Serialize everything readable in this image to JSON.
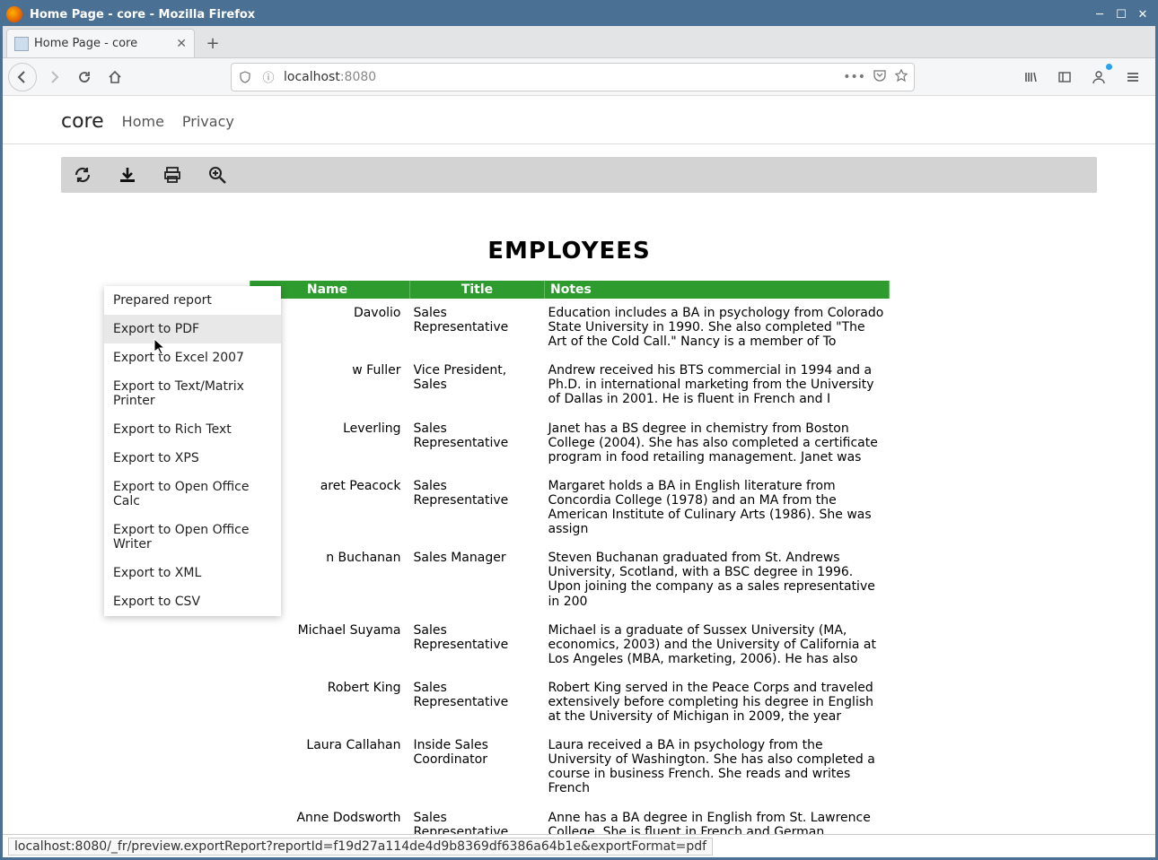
{
  "window": {
    "title": "Home Page - core - Mozilla Firefox"
  },
  "browser": {
    "tab_title": "Home Page - core",
    "url_host": "localhost",
    "url_port": ":8080"
  },
  "site": {
    "brand": "core",
    "nav": {
      "home": "Home",
      "privacy": "Privacy"
    }
  },
  "export_menu": {
    "items": [
      "Prepared report",
      "Export to PDF",
      "Export to Excel 2007",
      "Export to Text/Matrix Printer",
      "Export to Rich Text",
      "Export to XPS",
      "Export to Open Office Calc",
      "Export to Open Office Writer",
      "Export to XML",
      "Export to CSV"
    ],
    "hovered_index": 1
  },
  "report": {
    "title": "EMPLOYEES",
    "columns": {
      "name": "Name",
      "title": "Title",
      "notes": "Notes"
    },
    "rows": [
      {
        "name": "Davolio",
        "title": "Sales Representative",
        "notes": "Education includes a BA in psychology from Colorado State University in 1990.  She also completed \"The Art of the Cold Call.\"  Nancy is a member of To"
      },
      {
        "name": "w  Fuller",
        "title": "Vice President, Sales",
        "notes": "Andrew received his BTS commercial in 1994 and a Ph.D. in international marketing from the University of Dallas in 2001.  He is fluent in French and I"
      },
      {
        "name": "Leverling",
        "title": "Sales Representative",
        "notes": "Janet has a BS degree in chemistry from Boston College (2004).  She has also completed a certificate program in food retailing management.  Janet was"
      },
      {
        "name": "aret  Peacock",
        "title": "Sales Representative",
        "notes": "Margaret holds a BA in English literature from Concordia College (1978) and an MA from the American Institute of Culinary Arts (1986).  She was assign"
      },
      {
        "name": "n  Buchanan",
        "title": "Sales Manager",
        "notes": "Steven Buchanan graduated from St. Andrews University, Scotland, with a BSC degree in 1996.  Upon joining the company as a sales representative in 200"
      },
      {
        "name": "Michael  Suyama",
        "title": "Sales Representative",
        "notes": "Michael is a graduate of Sussex University (MA, economics, 2003) and the University of California at Los Angeles (MBA, marketing, 2006).  He has also"
      },
      {
        "name": "Robert  King",
        "title": "Sales Representative",
        "notes": "Robert King served in the Peace Corps and traveled extensively before completing his degree in English at the University of Michigan in 2009, the year"
      },
      {
        "name": "Laura  Callahan",
        "title": "Inside Sales Coordinator",
        "notes": "Laura received a BA in psychology from the University of Washington.  She has also completed a course in business French.  She reads and writes French"
      },
      {
        "name": "Anne  Dodsworth",
        "title": "Sales Representative",
        "notes": "Anne has a BA degree in English from St. Lawrence College.  She is fluent in French and German."
      }
    ]
  },
  "status_bar": {
    "text": "localhost:8080/_fr/preview.exportReport?reportId=f19d27a114de4d9b8369df6386a64b1e&exportFormat=pdf"
  }
}
